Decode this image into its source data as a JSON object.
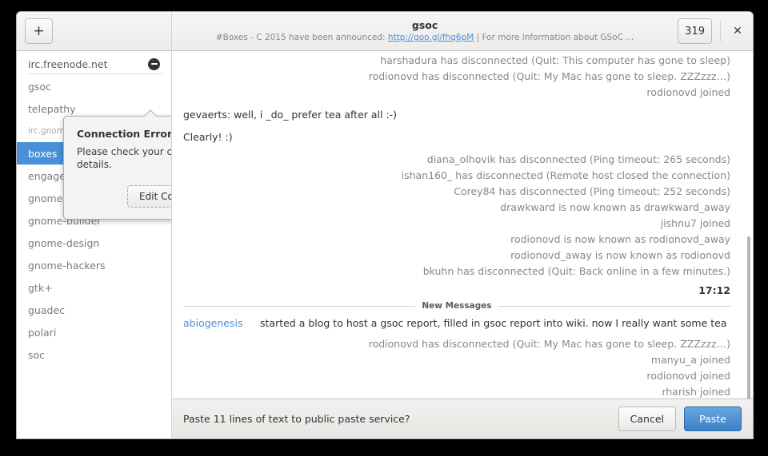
{
  "window": {
    "title": "gsoc",
    "subtitle_before": "#Boxes -  C 2015 have been announced: ",
    "subtitle_link": "http://goo.gl/fhq6pM",
    "subtitle_after": " | For more information about GSoC ...",
    "user_count": "319",
    "close_label": "✕",
    "add_label": "+"
  },
  "colors": {
    "accent": "#4a90d9",
    "selected_bg": "#4a90d9",
    "link": "#4a90d9",
    "status_text": "#8a8785",
    "primary_text": "#2e3436",
    "error_icon": "#2e3436"
  },
  "sidebar": {
    "rooms": [
      {
        "label": "irc.freenode.net",
        "type": "server",
        "status_icon": "error-circle-icon",
        "selected": false
      },
      {
        "label": "gsoc",
        "type": "room",
        "selected": false
      },
      {
        "label": "telepathy",
        "type": "room",
        "selected": false
      },
      {
        "label": "irc.gnome.org",
        "type": "server-small",
        "selected": false
      },
      {
        "label": "boxes",
        "type": "room",
        "selected": true
      },
      {
        "label": "engagement",
        "type": "room",
        "selected": false
      },
      {
        "label": "gnome",
        "type": "room",
        "selected": false
      },
      {
        "label": "gnome-builder",
        "type": "room",
        "selected": false
      },
      {
        "label": "gnome-design",
        "type": "room",
        "selected": false
      },
      {
        "label": "gnome-hackers",
        "type": "room",
        "selected": false
      },
      {
        "label": "gtk+",
        "type": "room",
        "selected": false
      },
      {
        "label": "guadec",
        "type": "room",
        "selected": false
      },
      {
        "label": "polari",
        "type": "room",
        "selected": false
      },
      {
        "label": "soc",
        "type": "room",
        "selected": false
      }
    ]
  },
  "popover": {
    "title": "Connection Error",
    "text": "Please check your connection details.",
    "button_label": "Edit Connection"
  },
  "chat": {
    "messages_top": [
      {
        "kind": "status",
        "text": "harshadura has disconnected (Quit: This computer has gone to sleep)"
      },
      {
        "kind": "status",
        "text": "rodionovd has disconnected (Quit: My Mac has gone to sleep. ZZZzzz…)"
      },
      {
        "kind": "status",
        "text": "rodionovd joined"
      }
    ],
    "messages_normal": [
      {
        "kind": "normal",
        "text": "gevaerts: well, i _do_ prefer tea after all :-)"
      },
      {
        "kind": "normal",
        "text": "Clearly! :)"
      }
    ],
    "messages_mid": [
      {
        "kind": "status",
        "text": "diana_olhovik has disconnected (Ping timeout: 265 seconds)"
      },
      {
        "kind": "status",
        "text": "ishan160_ has disconnected (Remote host closed the connection)"
      },
      {
        "kind": "status",
        "text": "Corey84 has disconnected (Ping timeout: 252 seconds)"
      },
      {
        "kind": "status",
        "text": "drawkward is now known as drawkward_away"
      },
      {
        "kind": "status",
        "text": "jishnu7 joined"
      },
      {
        "kind": "status",
        "text": "rodionovd is now known as rodionovd_away"
      },
      {
        "kind": "status",
        "text": "rodionovd_away is now known as rodionovd"
      },
      {
        "kind": "status",
        "text": "bkuhn has disconnected (Quit: Back online in a few minutes.)"
      }
    ],
    "timestamp": "17:12",
    "new_messages_label": "New Messages",
    "new_message": {
      "nick": "abiogenesis",
      "text": "started a blog to host a gsoc report, filled in gsoc report into wiki. now I really want some tea"
    },
    "messages_bottom": [
      {
        "kind": "status",
        "text": "rodionovd has disconnected (Quit: My Mac has gone to sleep. ZZZzzz…)"
      },
      {
        "kind": "status",
        "text": "manyu_a joined"
      },
      {
        "kind": "status",
        "text": "rodionovd joined"
      },
      {
        "kind": "status",
        "text": "rharish joined"
      }
    ]
  },
  "paste_bar": {
    "message": "Paste 11 lines of text to public paste service?",
    "cancel_label": "Cancel",
    "paste_label": "Paste"
  }
}
